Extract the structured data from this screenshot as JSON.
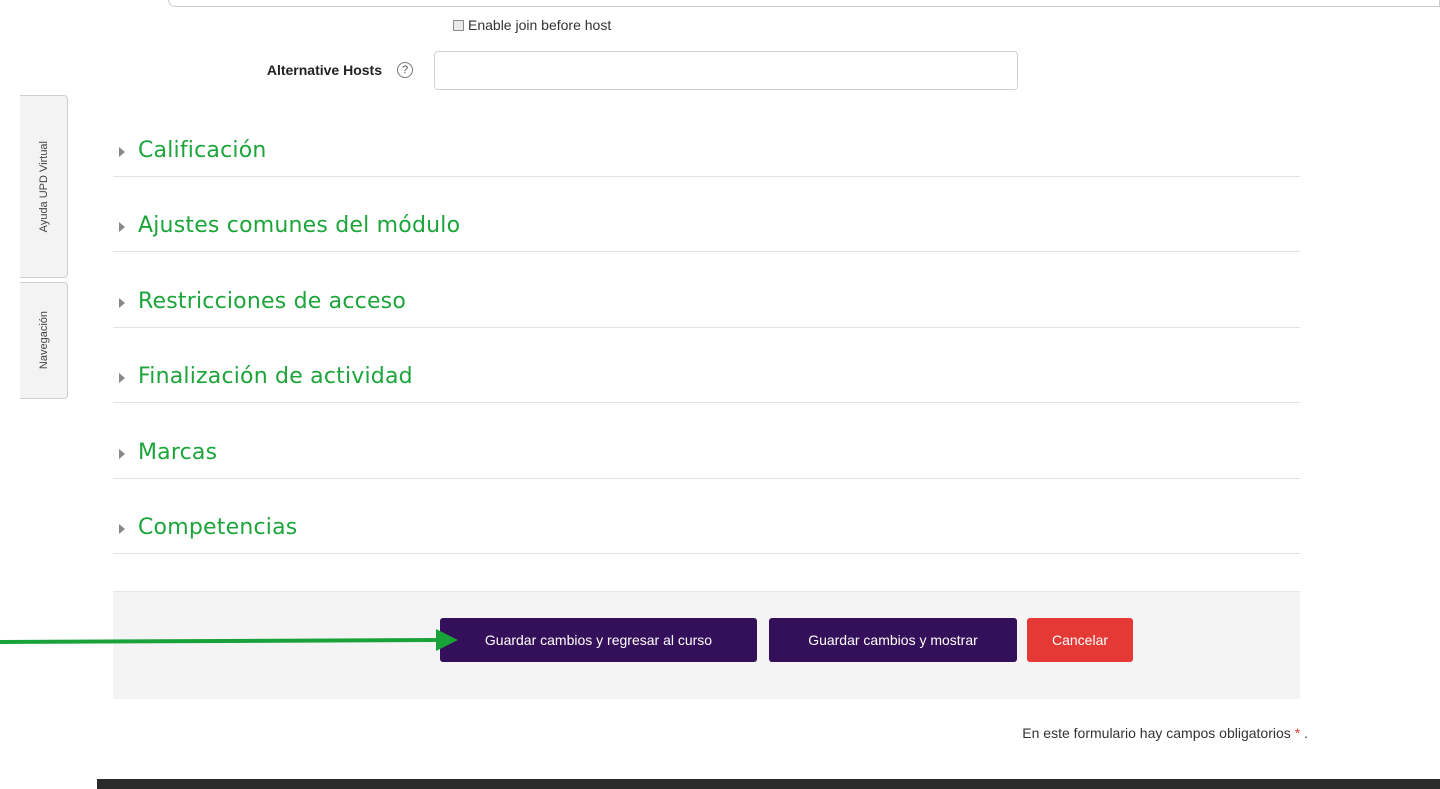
{
  "form": {
    "enable_join_label": "Enable join before host",
    "alternative_hosts_label": "Alternative Hosts",
    "alternative_hosts_value": "",
    "help_icon": "question-circle-icon"
  },
  "sidebar_tabs": {
    "help": "Ayuda UPD Virtual",
    "navigation": "Navegación"
  },
  "sections": [
    {
      "title": "Calificación"
    },
    {
      "title": "Ajustes comunes del módulo"
    },
    {
      "title": "Restricciones de acceso"
    },
    {
      "title": "Finalización de actividad"
    },
    {
      "title": "Marcas"
    },
    {
      "title": "Competencias"
    }
  ],
  "actions": {
    "save_return": "Guardar cambios y regresar al curso",
    "save_show": "Guardar cambios y mostrar",
    "cancel": "Cancelar"
  },
  "required_note": {
    "text": "En este formulario hay campos obligatorios",
    "marker": "*",
    "suffix": "."
  },
  "colors": {
    "section_title": "#1ca53b",
    "primary_button": "#34105a",
    "cancel_button": "#e53935",
    "arrow": "#1aa23a"
  }
}
